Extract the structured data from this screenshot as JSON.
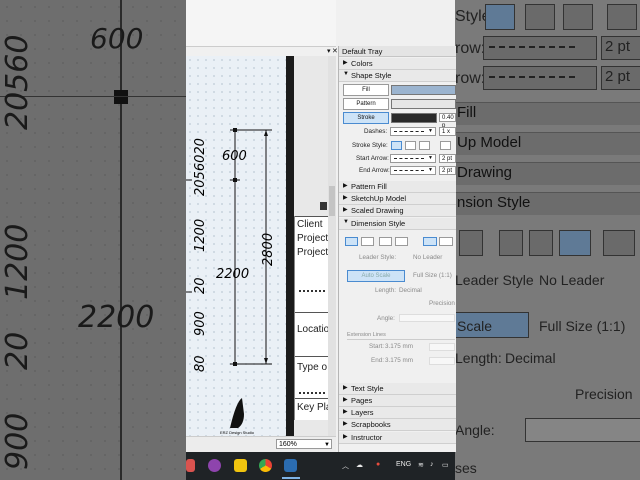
{
  "bg_left": {
    "dims": [
      "600",
      "20560",
      "1200",
      "2200",
      "20",
      "900"
    ]
  },
  "bg_right": {
    "partial_labels": [
      "Style:",
      "row:",
      "row:"
    ],
    "panels": [
      "Fill",
      "Up Model",
      "Drawing",
      "nsion Style"
    ],
    "leader_style_label": "Leader Style",
    "leader_style_value": "No Leader",
    "scale_label": "Scale",
    "scale_value": "Full Size (1:1)",
    "length_label": "Length:",
    "length_value": "Decimal",
    "precision_label": "Precision",
    "angle_label": "Angle:",
    "bottom_label": "ses",
    "pt_values": [
      "2 pt",
      "2 pt"
    ]
  },
  "drawing": {
    "dims": [
      "600",
      "2056020",
      "1200",
      "2200",
      "2800",
      "20",
      "900",
      "80"
    ],
    "titleblock": [
      "Client",
      "Project",
      "Project",
      "Location",
      "Type o",
      "Key Pla"
    ],
    "logo_text": "ERZ Design Studio",
    "zoom": "160%"
  },
  "tray": {
    "title": "Default Tray",
    "panels": {
      "colors": "Colors",
      "shape_style": "Shape Style",
      "pattern_fill": "Pattern Fill",
      "sketchup_model": "SketchUp Model",
      "scaled_drawing": "Scaled Drawing",
      "dimension_style": "Dimension Style",
      "text_style": "Text Style",
      "pages": "Pages",
      "layers": "Layers",
      "scrapbooks": "Scrapbooks",
      "instructor": "Instructor"
    },
    "shape_style": {
      "fill": "Fill",
      "pattern": "Pattern",
      "stroke": "Stroke",
      "stroke_width": "0.40 p",
      "dashes_label": "Dashes:",
      "dash_scale": "1 x",
      "stroke_style_label": "Stroke Style:",
      "start_arrow_label": "Start Arrow:",
      "start_arrow_size": "2 pt",
      "end_arrow_label": "End Arrow:",
      "end_arrow_size": "2 pt"
    },
    "dimension_style": {
      "leader_style_label": "Leader Style:",
      "leader_style_value": "No Leader",
      "auto_scale": "Auto Scale",
      "scale_value": "Full Size (1:1)",
      "length_label": "Length:",
      "length_value": "Decimal",
      "precision_label": "Precision",
      "angle_label": "Angle:",
      "extension_lines": "Extension Lines",
      "start_label": "Start:",
      "start_value": "3.175 mm",
      "end_label": "End:",
      "end_value": "3.175 mm"
    }
  },
  "taskbar": {
    "lang": "ENG"
  },
  "colors": {
    "fill_swatch": "#9bb4cf",
    "stroke_swatch": "#2a2a2a",
    "accent": "#4a8bd0"
  }
}
